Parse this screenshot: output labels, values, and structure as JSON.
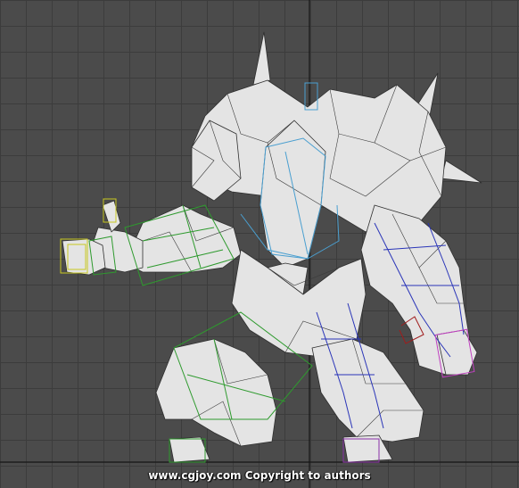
{
  "viewport": {
    "background": "#4b4b4b",
    "grid_color": "#3c3c3c",
    "axis_color": "#111111",
    "mesh_color": "#e6e6e6",
    "wire_color": "#2e2e2e"
  },
  "model": {
    "rig_colors": {
      "left_arm_bones": "#2e9a2e",
      "spine_bones": "#4a9fd0",
      "right_arm_bones": "#2a35b8",
      "right_leg_bones": "#2a35b8",
      "left_leg_bones": "#2e9a2e",
      "left_hand_box": "#c8c820",
      "right_hand_box": "#c040c0",
      "tail_bones": "#a01c1c"
    }
  },
  "watermark": {
    "text": "www.cgjoy.com  Copyright to authors"
  }
}
